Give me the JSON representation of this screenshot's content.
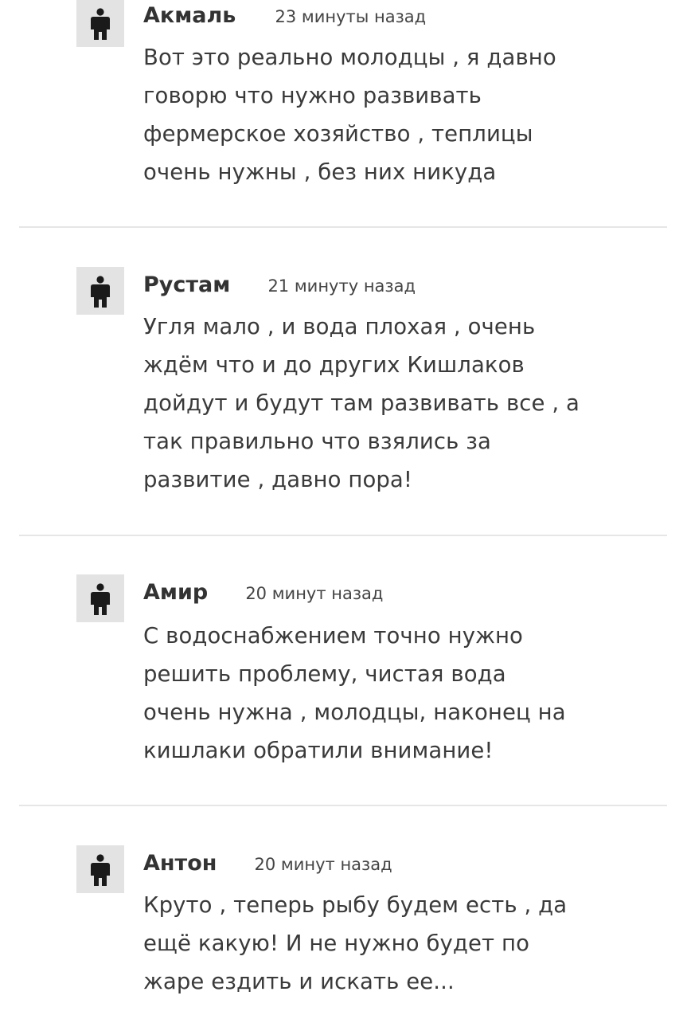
{
  "comments": [
    {
      "author": "Акмаль",
      "time": "23 минуты назад",
      "lines": [
        "Вот это реально молодцы , я давно",
        "говорю что нужно развивать",
        "фермерское хозяйство , теплицы",
        "очень нужны , без них никуда"
      ]
    },
    {
      "author": "Рустам",
      "time": "21 минуту назад",
      "lines": [
        "Угля мало , и вода плохая , очень",
        "ждём что и до других Кишлаков",
        "дойдут и будут там развивать все , а",
        "так правильно что взялись за",
        "развитие , давно пора!"
      ]
    },
    {
      "author": "Амир",
      "time": "20 минут назад",
      "lines": [
        "С водоснабжением точно нужно",
        "решить проблему, чистая вода",
        "очень нужна , молодцы, наконец на",
        "кишлаки обратили внимание!"
      ]
    },
    {
      "author": "Антон",
      "time": "20 минут назад",
      "lines": [
        "Круто , теперь рыбу будем есть , да",
        "ещё какую! И не нужно будет по",
        "жаре ездить и искать ее..."
      ]
    }
  ],
  "icons": {
    "avatar": "user-silhouette-icon"
  },
  "colors": {
    "avatar_bg": "#e3e3e3",
    "avatar_icon": "#1a1a1a",
    "divider": "#e6e6e6",
    "text": "#3a3a3a"
  }
}
